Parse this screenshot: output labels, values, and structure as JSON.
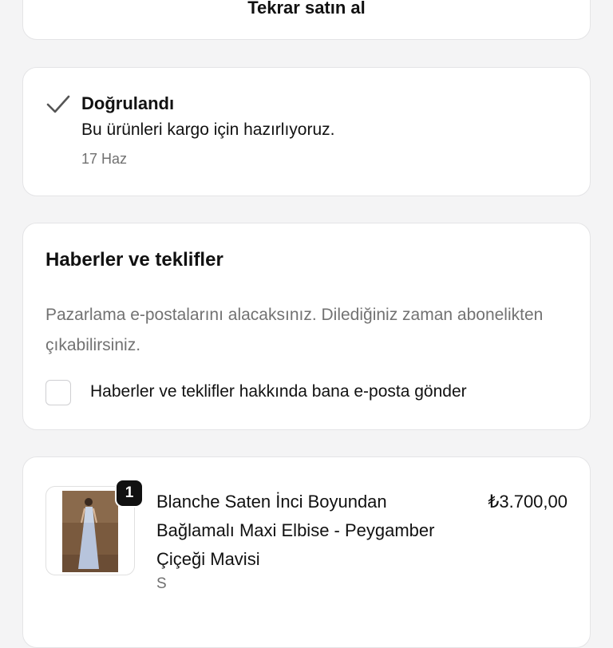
{
  "reorder": {
    "label": "Tekrar satın al"
  },
  "status": {
    "icon": "check-icon",
    "title": "Doğrulandı",
    "description": "Bu ürünleri kargo için hazırlıyoruz.",
    "date": "17 Haz"
  },
  "news": {
    "title": "Haberler ve teklifler",
    "description": "Pazarlama e-postalarını alacaksınız. Dilediğiniz zaman abonelikten çıkabilirsiniz.",
    "checkbox_label": "Haberler ve teklifler hakkında bana e-posta gönder",
    "checked": false
  },
  "product": {
    "quantity": "1",
    "name": "Blanche Saten İnci Boyundan Bağlamalı Maxi Elbise - Peygamber Çiçeği Mavisi",
    "variant": "S",
    "price": "₺3.700,00",
    "image_icon": "dress-photo"
  },
  "colors": {
    "background": "#f4f4f5",
    "card": "#ffffff",
    "muted_text": "#727272",
    "badge": "#111111"
  }
}
